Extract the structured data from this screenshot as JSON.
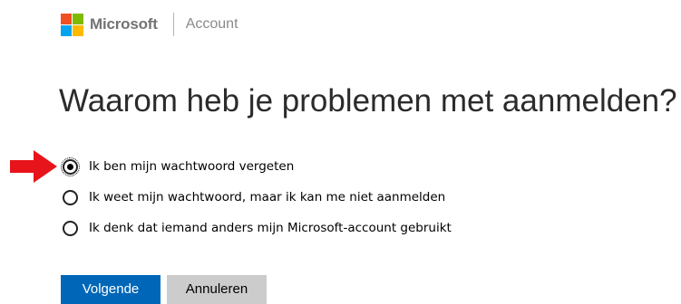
{
  "header": {
    "brand": "Microsoft",
    "product": "Account",
    "logo_colors": [
      "#f25022",
      "#7fba00",
      "#00a4ef",
      "#ffb900"
    ]
  },
  "page": {
    "title": "Waarom heb je problemen met aanmelden?"
  },
  "options": [
    {
      "label": "Ik ben mijn wachtwoord vergeten",
      "selected": true
    },
    {
      "label": "Ik weet mijn wachtwoord, maar ik kan me niet aanmelden",
      "selected": false
    },
    {
      "label": "Ik denk dat iemand anders mijn Microsoft-account gebruikt",
      "selected": false
    }
  ],
  "annotation": {
    "arrow_color": "#e8141b",
    "arrow_icon": "red-arrow-icon"
  },
  "buttons": {
    "next_label": "Volgende",
    "cancel_label": "Annuleren",
    "primary_color": "#0067b8",
    "secondary_color": "#cccccc"
  }
}
